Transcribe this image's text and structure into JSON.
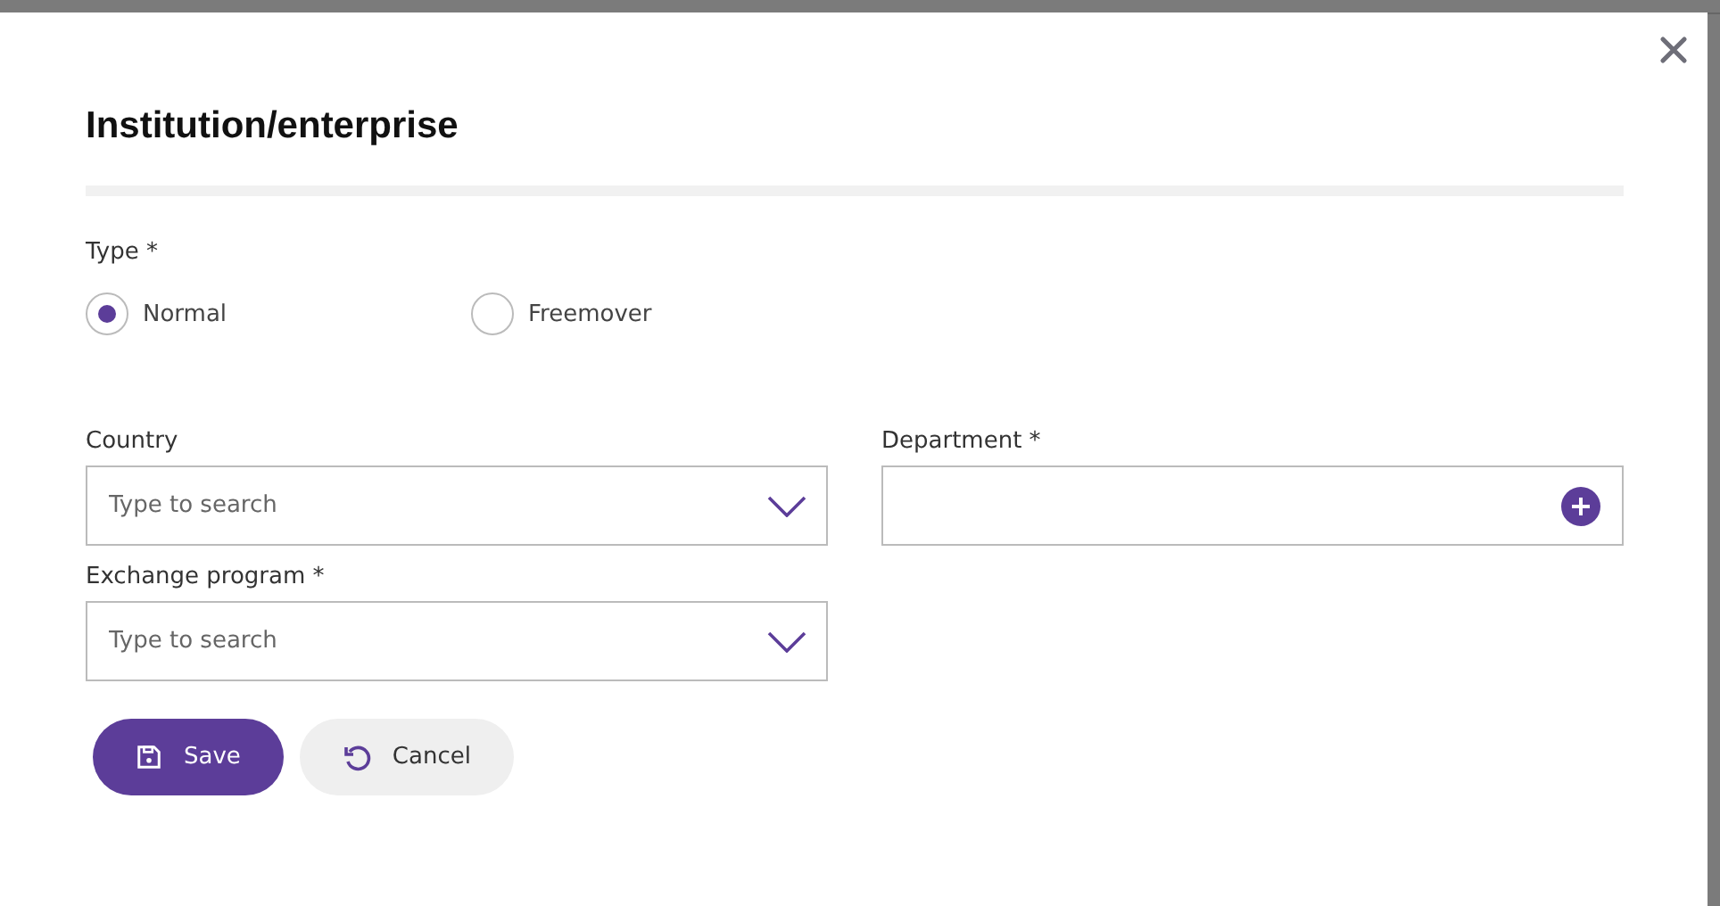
{
  "dialog": {
    "title": "Institution/enterprise",
    "type_field": {
      "label": "Type *",
      "options": [
        {
          "label": "Normal",
          "selected": true
        },
        {
          "label": "Freemover",
          "selected": false
        }
      ]
    },
    "fields": [
      {
        "kind": "dropdown",
        "label": "Country",
        "placeholder": "Type to search"
      },
      {
        "kind": "add",
        "label": "Department *"
      },
      {
        "kind": "dropdown",
        "label": "Exchange program *",
        "placeholder": "Type to search"
      }
    ],
    "buttons": [
      {
        "kind": "save",
        "label": "Save"
      },
      {
        "kind": "cancel",
        "label": "Cancel"
      }
    ]
  }
}
